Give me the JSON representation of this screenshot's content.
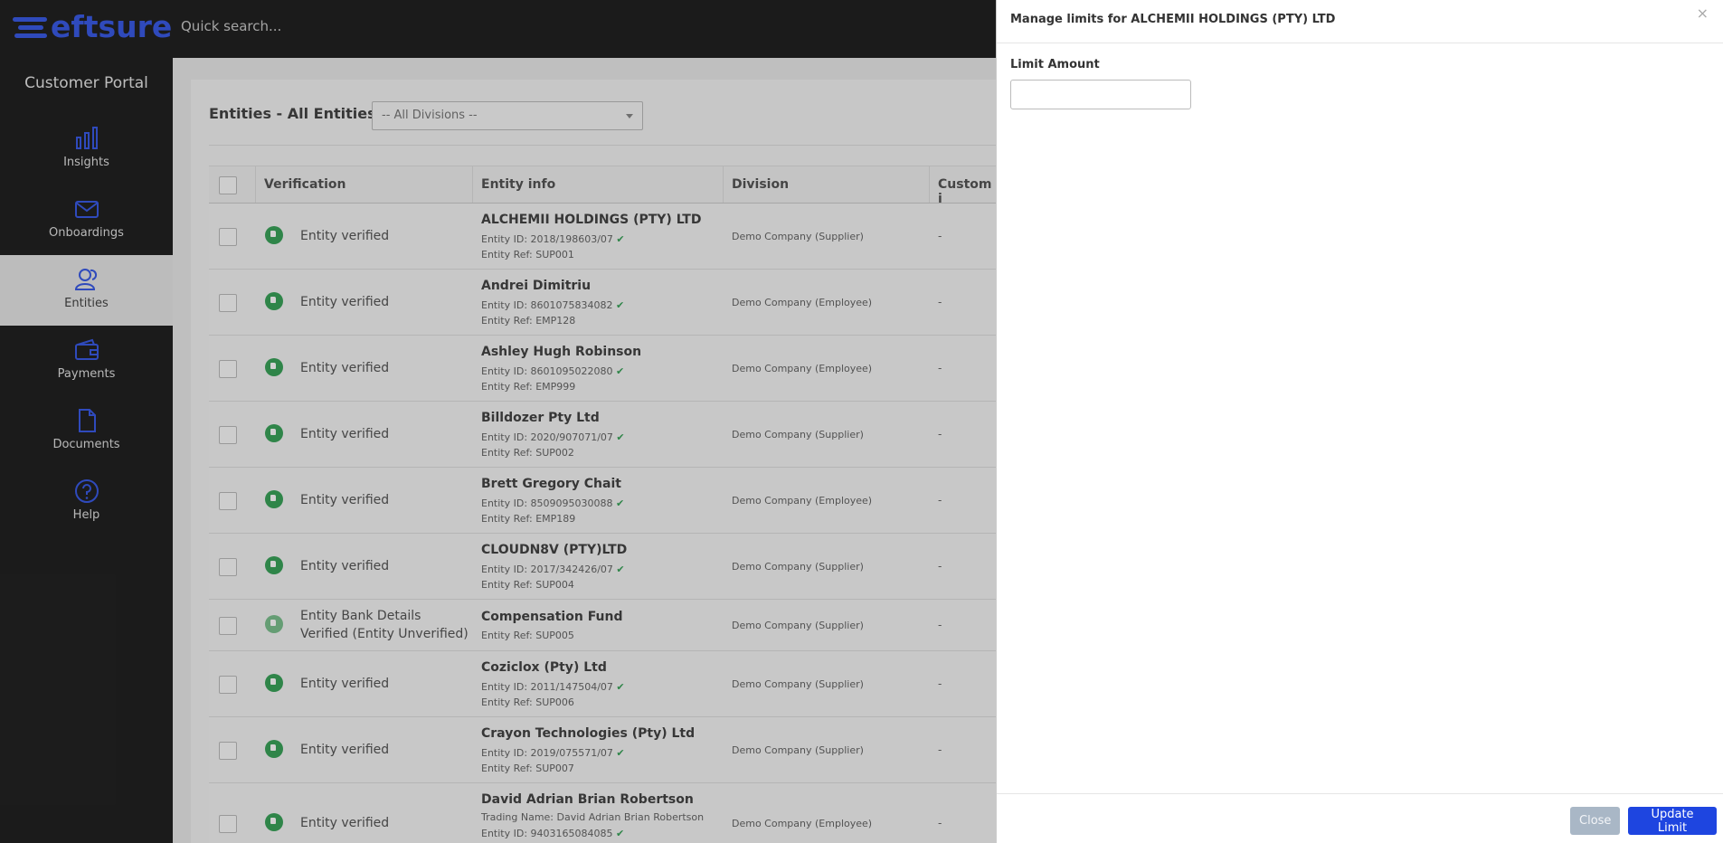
{
  "brand": {
    "logo_text": "eftsure",
    "brand_color": "#3a5be6"
  },
  "search": {
    "placeholder": "Quick search..."
  },
  "sidebar": {
    "title": "Customer Portal",
    "items": [
      {
        "label": "Insights",
        "icon": "bar-chart-icon"
      },
      {
        "label": "Onboardings",
        "icon": "envelope-icon"
      },
      {
        "label": "Entities",
        "icon": "users-icon",
        "active": true
      },
      {
        "label": "Payments",
        "icon": "wallet-icon"
      },
      {
        "label": "Documents",
        "icon": "document-icon"
      },
      {
        "label": "Help",
        "icon": "help-icon"
      }
    ]
  },
  "content": {
    "title": "Entities - All Entities",
    "division_filter": "-- All Divisions --",
    "columns": [
      "Verification",
      "Entity info",
      "Division",
      "Custom i"
    ],
    "rows": [
      {
        "verification": "Entity verified",
        "name": "ALCHEMII HOLDINGS (PTY) LTD",
        "line1": "Entity ID: 2018/198603/07",
        "line2": "Entity Ref: SUP001",
        "division": "Demo Company (Supplier)",
        "custom": "-"
      },
      {
        "verification": "Entity verified",
        "name": "Andrei Dimitriu",
        "line1": "Entity ID: 8601075834082",
        "line2": "Entity Ref: EMP128",
        "division": "Demo Company (Employee)",
        "custom": "-"
      },
      {
        "verification": "Entity verified",
        "name": "Ashley Hugh Robinson",
        "line1": "Entity ID: 8601095022080",
        "line2": "Entity Ref: EMP999",
        "division": "Demo Company (Employee)",
        "custom": "-"
      },
      {
        "verification": "Entity verified",
        "name": "Billdozer Pty Ltd",
        "line1": "Entity ID: 2020/907071/07",
        "line2": "Entity Ref: SUP002",
        "division": "Demo Company (Supplier)",
        "custom": "-"
      },
      {
        "verification": "Entity verified",
        "name": "Brett Gregory Chait",
        "line1": "Entity ID: 8509095030088",
        "line2": "Entity Ref: EMP189",
        "division": "Demo Company (Employee)",
        "custom": "-"
      },
      {
        "verification": "Entity verified",
        "name": "CLOUDN8V (PTY)LTD",
        "line1": "Entity ID: 2017/342426/07",
        "line2": "Entity Ref: SUP004",
        "division": "Demo Company (Supplier)",
        "custom": "-"
      },
      {
        "verification": "Entity Bank Details Verified (Entity Unverified)",
        "name": "Compensation Fund",
        "line1": "Entity Ref: SUP005",
        "line2": "",
        "division": "Demo Company (Supplier)",
        "custom": "-"
      },
      {
        "verification": "Entity verified",
        "name": "Coziclox (Pty) Ltd",
        "line1": "Entity ID: 2011/147504/07",
        "line2": "Entity Ref: SUP006",
        "division": "Demo Company (Supplier)",
        "custom": "-"
      },
      {
        "verification": "Entity verified",
        "name": "Crayon Technologies (Pty) Ltd",
        "line1": "Entity ID: 2019/075571/07",
        "line2": "Entity Ref: SUP007",
        "division": "Demo Company (Supplier)",
        "custom": "-"
      },
      {
        "verification": "Entity verified",
        "name": "David Adrian Brian Robertson",
        "line1": "Trading Name: David Adrian Brian Robertson",
        "line2": "Entity ID: 9403165084085",
        "division": "Demo Company (Employee)",
        "custom": "-"
      }
    ]
  },
  "panel": {
    "title": "Manage limits for ALCHEMII HOLDINGS (PTY) LTD",
    "close_x": "×",
    "field_label": "Limit Amount",
    "limit_value": "",
    "close_label": "Close",
    "update_label": "Update Limit",
    "primary_color": "#1e45e0"
  }
}
